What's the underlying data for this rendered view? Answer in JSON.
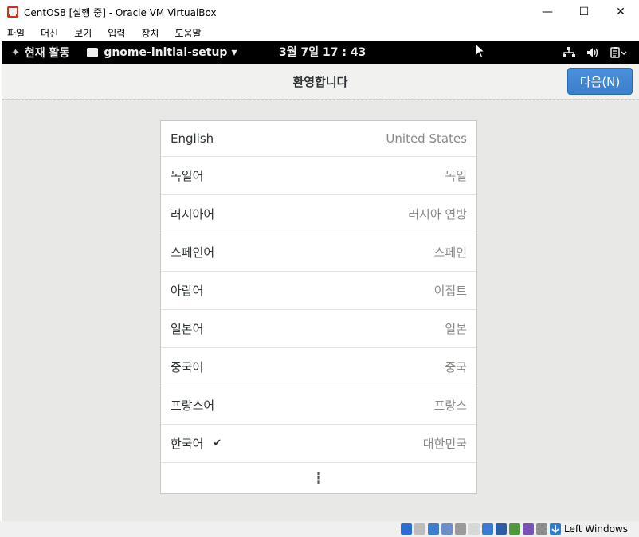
{
  "window": {
    "title": "CentOS8 [실행 중] - Oracle VM VirtualBox",
    "controls": {
      "minimize": "—",
      "maximize": "☐",
      "close": "✕"
    }
  },
  "menubar": [
    "파일",
    "머신",
    "보기",
    "입력",
    "장치",
    "도움말"
  ],
  "topbar": {
    "activities": "현재 활동",
    "app_name": "gnome-initial-setup",
    "app_arrow": "▾",
    "clock": "3월 7일  17 : 43",
    "network_icon": "⛶",
    "volume_icon": "🔊",
    "clipboard_icon": "▤▾"
  },
  "setup": {
    "title": "환영합니다",
    "next_button": "다음(N)",
    "languages": [
      {
        "name": "English",
        "region": "United States",
        "checked": false
      },
      {
        "name": "독일어",
        "region": "독일",
        "checked": false
      },
      {
        "name": "러시아어",
        "region": "러시아 연방",
        "checked": false
      },
      {
        "name": "스페인어",
        "region": "스페인",
        "checked": false
      },
      {
        "name": "아랍어",
        "region": "이집트",
        "checked": false
      },
      {
        "name": "일본어",
        "region": "일본",
        "checked": false
      },
      {
        "name": "중국어",
        "region": "중국",
        "checked": false
      },
      {
        "name": "프랑스어",
        "region": "프랑스",
        "checked": false
      },
      {
        "name": "한국어",
        "region": "대한민국",
        "checked": true
      }
    ],
    "check_mark": "✔",
    "more_dots": "⋮"
  },
  "statusbar": {
    "host_key": "Left Windows",
    "icon_colors": [
      "#2a6fd6",
      "#bdbdbd",
      "#3d7cd0",
      "#6b8fc9",
      "#9a9a9a",
      "#d8d8d8",
      "#3a7bd5",
      "#2c5fa8",
      "#4f9a3a",
      "#7a52b8",
      "#8e8e8e",
      "#2f7fd0"
    ]
  }
}
